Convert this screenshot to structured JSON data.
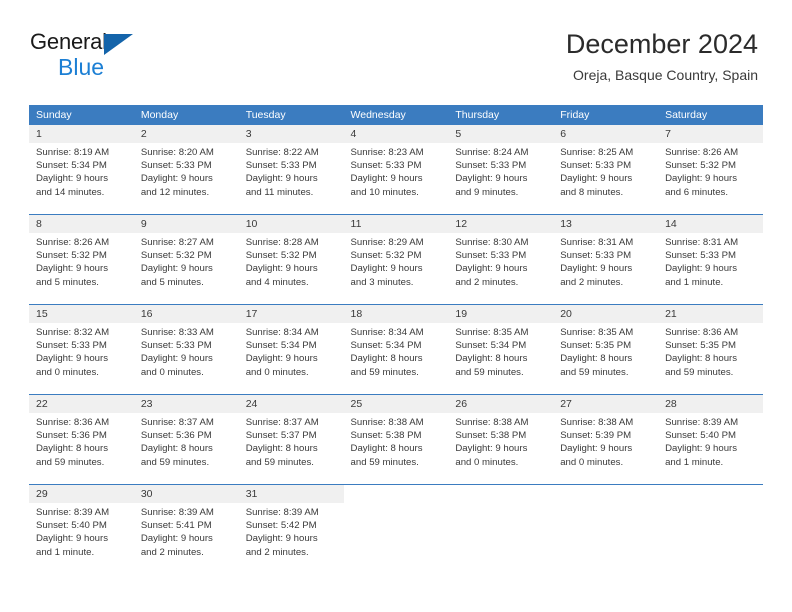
{
  "brand": {
    "line1": "General",
    "line2": "Blue",
    "mark_icon": "triangle-flag-icon",
    "accent_color": "#1c7fd4",
    "mark_color": "#1464aa"
  },
  "header": {
    "title": "December 2024",
    "subtitle": "Oreja, Basque Country, Spain"
  },
  "colors": {
    "weekday_header_bg": "#3b7cc0",
    "weekday_header_text": "#ffffff",
    "day_band_bg": "#f0f0f0",
    "grid_line": "#3b7cc0",
    "body_text": "#3a3a3a"
  },
  "labels": {
    "sunrise_prefix": "Sunrise:",
    "sunset_prefix": "Sunset:",
    "daylight_prefix": "Daylight:"
  },
  "weekdays": [
    "Sunday",
    "Monday",
    "Tuesday",
    "Wednesday",
    "Thursday",
    "Friday",
    "Saturday"
  ],
  "weeks": [
    [
      {
        "day": "1",
        "sunrise": "Sunrise: 8:19 AM",
        "sunset": "Sunset: 5:34 PM",
        "daylight_line1": "Daylight: 9 hours",
        "daylight_line2": "and 14 minutes."
      },
      {
        "day": "2",
        "sunrise": "Sunrise: 8:20 AM",
        "sunset": "Sunset: 5:33 PM",
        "daylight_line1": "Daylight: 9 hours",
        "daylight_line2": "and 12 minutes."
      },
      {
        "day": "3",
        "sunrise": "Sunrise: 8:22 AM",
        "sunset": "Sunset: 5:33 PM",
        "daylight_line1": "Daylight: 9 hours",
        "daylight_line2": "and 11 minutes."
      },
      {
        "day": "4",
        "sunrise": "Sunrise: 8:23 AM",
        "sunset": "Sunset: 5:33 PM",
        "daylight_line1": "Daylight: 9 hours",
        "daylight_line2": "and 10 minutes."
      },
      {
        "day": "5",
        "sunrise": "Sunrise: 8:24 AM",
        "sunset": "Sunset: 5:33 PM",
        "daylight_line1": "Daylight: 9 hours",
        "daylight_line2": "and 9 minutes."
      },
      {
        "day": "6",
        "sunrise": "Sunrise: 8:25 AM",
        "sunset": "Sunset: 5:33 PM",
        "daylight_line1": "Daylight: 9 hours",
        "daylight_line2": "and 8 minutes."
      },
      {
        "day": "7",
        "sunrise": "Sunrise: 8:26 AM",
        "sunset": "Sunset: 5:32 PM",
        "daylight_line1": "Daylight: 9 hours",
        "daylight_line2": "and 6 minutes."
      }
    ],
    [
      {
        "day": "8",
        "sunrise": "Sunrise: 8:26 AM",
        "sunset": "Sunset: 5:32 PM",
        "daylight_line1": "Daylight: 9 hours",
        "daylight_line2": "and 5 minutes."
      },
      {
        "day": "9",
        "sunrise": "Sunrise: 8:27 AM",
        "sunset": "Sunset: 5:32 PM",
        "daylight_line1": "Daylight: 9 hours",
        "daylight_line2": "and 5 minutes."
      },
      {
        "day": "10",
        "sunrise": "Sunrise: 8:28 AM",
        "sunset": "Sunset: 5:32 PM",
        "daylight_line1": "Daylight: 9 hours",
        "daylight_line2": "and 4 minutes."
      },
      {
        "day": "11",
        "sunrise": "Sunrise: 8:29 AM",
        "sunset": "Sunset: 5:32 PM",
        "daylight_line1": "Daylight: 9 hours",
        "daylight_line2": "and 3 minutes."
      },
      {
        "day": "12",
        "sunrise": "Sunrise: 8:30 AM",
        "sunset": "Sunset: 5:33 PM",
        "daylight_line1": "Daylight: 9 hours",
        "daylight_line2": "and 2 minutes."
      },
      {
        "day": "13",
        "sunrise": "Sunrise: 8:31 AM",
        "sunset": "Sunset: 5:33 PM",
        "daylight_line1": "Daylight: 9 hours",
        "daylight_line2": "and 2 minutes."
      },
      {
        "day": "14",
        "sunrise": "Sunrise: 8:31 AM",
        "sunset": "Sunset: 5:33 PM",
        "daylight_line1": "Daylight: 9 hours",
        "daylight_line2": "and 1 minute."
      }
    ],
    [
      {
        "day": "15",
        "sunrise": "Sunrise: 8:32 AM",
        "sunset": "Sunset: 5:33 PM",
        "daylight_line1": "Daylight: 9 hours",
        "daylight_line2": "and 0 minutes."
      },
      {
        "day": "16",
        "sunrise": "Sunrise: 8:33 AM",
        "sunset": "Sunset: 5:33 PM",
        "daylight_line1": "Daylight: 9 hours",
        "daylight_line2": "and 0 minutes."
      },
      {
        "day": "17",
        "sunrise": "Sunrise: 8:34 AM",
        "sunset": "Sunset: 5:34 PM",
        "daylight_line1": "Daylight: 9 hours",
        "daylight_line2": "and 0 minutes."
      },
      {
        "day": "18",
        "sunrise": "Sunrise: 8:34 AM",
        "sunset": "Sunset: 5:34 PM",
        "daylight_line1": "Daylight: 8 hours",
        "daylight_line2": "and 59 minutes."
      },
      {
        "day": "19",
        "sunrise": "Sunrise: 8:35 AM",
        "sunset": "Sunset: 5:34 PM",
        "daylight_line1": "Daylight: 8 hours",
        "daylight_line2": "and 59 minutes."
      },
      {
        "day": "20",
        "sunrise": "Sunrise: 8:35 AM",
        "sunset": "Sunset: 5:35 PM",
        "daylight_line1": "Daylight: 8 hours",
        "daylight_line2": "and 59 minutes."
      },
      {
        "day": "21",
        "sunrise": "Sunrise: 8:36 AM",
        "sunset": "Sunset: 5:35 PM",
        "daylight_line1": "Daylight: 8 hours",
        "daylight_line2": "and 59 minutes."
      }
    ],
    [
      {
        "day": "22",
        "sunrise": "Sunrise: 8:36 AM",
        "sunset": "Sunset: 5:36 PM",
        "daylight_line1": "Daylight: 8 hours",
        "daylight_line2": "and 59 minutes."
      },
      {
        "day": "23",
        "sunrise": "Sunrise: 8:37 AM",
        "sunset": "Sunset: 5:36 PM",
        "daylight_line1": "Daylight: 8 hours",
        "daylight_line2": "and 59 minutes."
      },
      {
        "day": "24",
        "sunrise": "Sunrise: 8:37 AM",
        "sunset": "Sunset: 5:37 PM",
        "daylight_line1": "Daylight: 8 hours",
        "daylight_line2": "and 59 minutes."
      },
      {
        "day": "25",
        "sunrise": "Sunrise: 8:38 AM",
        "sunset": "Sunset: 5:38 PM",
        "daylight_line1": "Daylight: 8 hours",
        "daylight_line2": "and 59 minutes."
      },
      {
        "day": "26",
        "sunrise": "Sunrise: 8:38 AM",
        "sunset": "Sunset: 5:38 PM",
        "daylight_line1": "Daylight: 9 hours",
        "daylight_line2": "and 0 minutes."
      },
      {
        "day": "27",
        "sunrise": "Sunrise: 8:38 AM",
        "sunset": "Sunset: 5:39 PM",
        "daylight_line1": "Daylight: 9 hours",
        "daylight_line2": "and 0 minutes."
      },
      {
        "day": "28",
        "sunrise": "Sunrise: 8:39 AM",
        "sunset": "Sunset: 5:40 PM",
        "daylight_line1": "Daylight: 9 hours",
        "daylight_line2": "and 1 minute."
      }
    ],
    [
      {
        "day": "29",
        "sunrise": "Sunrise: 8:39 AM",
        "sunset": "Sunset: 5:40 PM",
        "daylight_line1": "Daylight: 9 hours",
        "daylight_line2": "and 1 minute."
      },
      {
        "day": "30",
        "sunrise": "Sunrise: 8:39 AM",
        "sunset": "Sunset: 5:41 PM",
        "daylight_line1": "Daylight: 9 hours",
        "daylight_line2": "and 2 minutes."
      },
      {
        "day": "31",
        "sunrise": "Sunrise: 8:39 AM",
        "sunset": "Sunset: 5:42 PM",
        "daylight_line1": "Daylight: 9 hours",
        "daylight_line2": "and 2 minutes."
      },
      {
        "day": "",
        "sunrise": "",
        "sunset": "",
        "daylight_line1": "",
        "daylight_line2": ""
      },
      {
        "day": "",
        "sunrise": "",
        "sunset": "",
        "daylight_line1": "",
        "daylight_line2": ""
      },
      {
        "day": "",
        "sunrise": "",
        "sunset": "",
        "daylight_line1": "",
        "daylight_line2": ""
      },
      {
        "day": "",
        "sunrise": "",
        "sunset": "",
        "daylight_line1": "",
        "daylight_line2": ""
      }
    ]
  ]
}
